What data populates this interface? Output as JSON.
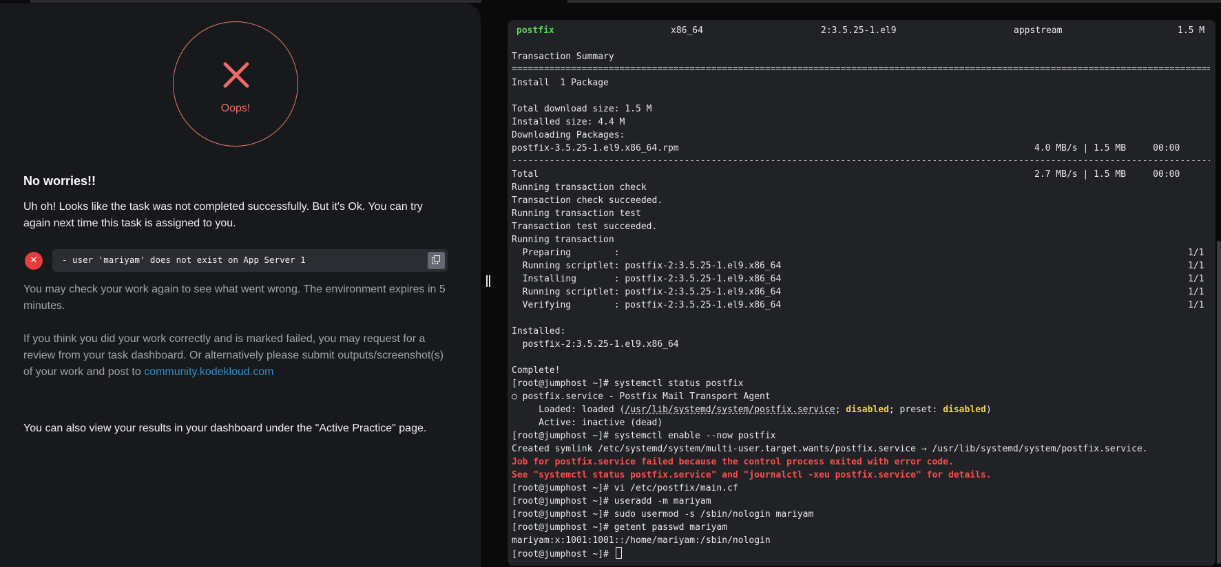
{
  "result": {
    "status_label": "Oops!",
    "heading": "No worries!!",
    "lead": "Uh oh! Looks like the task was not completed successfully. But it's Ok. You can try again next time this task is assigned to you.",
    "error_message": "- user 'mariyam' does not exist on App Server 1",
    "check_note": "You may check your work again to see what went wrong. The environment expires in 5 minutes.",
    "review_note": "If you think you did your work correctly and is marked failed, you may request for a review from your task dashboard. Or alternatively please submit outputs/screenshot(s) of your work and post to ",
    "community_link": "community.kodekloud.com",
    "dashboard_note": "You can also view your results in your dashboard under the \"Active Practice\" page."
  },
  "terminal": {
    "package_row": {
      "name": "postfix",
      "arch": "x86_64",
      "version": "2:3.5.25-1.el9",
      "repo": "appstream",
      "size": "1.5 M"
    },
    "summary_title": "Transaction Summary",
    "install_line": "Install  1 Package",
    "total_download": "Total download size: 1.5 M",
    "installed_size": "Installed size: 4.4 M",
    "downloading": "Downloading Packages:",
    "rpm_name": "postfix-3.5.25-1.el9.x86_64.rpm",
    "rpm_stats": "4.0 MB/s | 1.5 MB     00:00",
    "total_label": "Total",
    "total_stats": "2.7 MB/s | 1.5 MB     00:00",
    "transaction_lines": [
      "Running transaction check",
      "Transaction check succeeded.",
      "Running transaction test",
      "Transaction test succeeded.",
      "Running transaction"
    ],
    "steps": [
      {
        "label": "  Preparing        :",
        "count": "1/1"
      },
      {
        "label": "  Running scriptlet: postfix-2:3.5.25-1.el9.x86_64",
        "count": "1/1"
      },
      {
        "label": "  Installing       : postfix-2:3.5.25-1.el9.x86_64",
        "count": "1/1"
      },
      {
        "label": "  Running scriptlet: postfix-2:3.5.25-1.el9.x86_64",
        "count": "1/1"
      },
      {
        "label": "  Verifying        : postfix-2:3.5.25-1.el9.x86_64",
        "count": "1/1"
      }
    ],
    "installed_header": "Installed:",
    "installed_pkg": "  postfix-2:3.5.25-1.el9.x86_64",
    "complete": "Complete!",
    "cmd_status": "[root@jumphost ~]# systemctl status postfix",
    "svc_line": "○ postfix.service - Postfix Mail Transport Agent",
    "loaded_prefix": "     Loaded: loaded (",
    "loaded_path": "/usr/lib/systemd/system/postfix.service",
    "loaded_sep1": "; ",
    "loaded_disabled": "disabled",
    "loaded_sep2": "; preset: ",
    "loaded_preset": "disabled",
    "loaded_suffix": ")",
    "active_line": "     Active: inactive (dead)",
    "cmd_enable": "[root@jumphost ~]# systemctl enable --now postfix",
    "symlink_line": "Created symlink /etc/systemd/system/multi-user.target.wants/postfix.service → /usr/lib/systemd/system/postfix.service.",
    "err1": "Job for postfix.service failed because the control process exited with error code.",
    "err2": "See \"systemctl status postfix.service\" and \"journalctl -xeu postfix.service\" for details.",
    "cmd_vi": "[root@jumphost ~]# vi /etc/postfix/main.cf",
    "cmd_useradd": "[root@jumphost ~]# useradd -m mariyam",
    "cmd_usermod": "[root@jumphost ~]# sudo usermod -s /sbin/nologin mariyam",
    "cmd_getent": "[root@jumphost ~]# getent passwd mariyam",
    "getent_out": "mariyam:x:1001:1001::/home/mariyam:/sbin/nologin",
    "prompt": "[root@jumphost ~]# "
  },
  "colors": {
    "error_red": "#e53c3c",
    "link_blue": "#2f8fc9",
    "success_green": "#58d65f",
    "warn_yellow": "#f1d54a"
  }
}
